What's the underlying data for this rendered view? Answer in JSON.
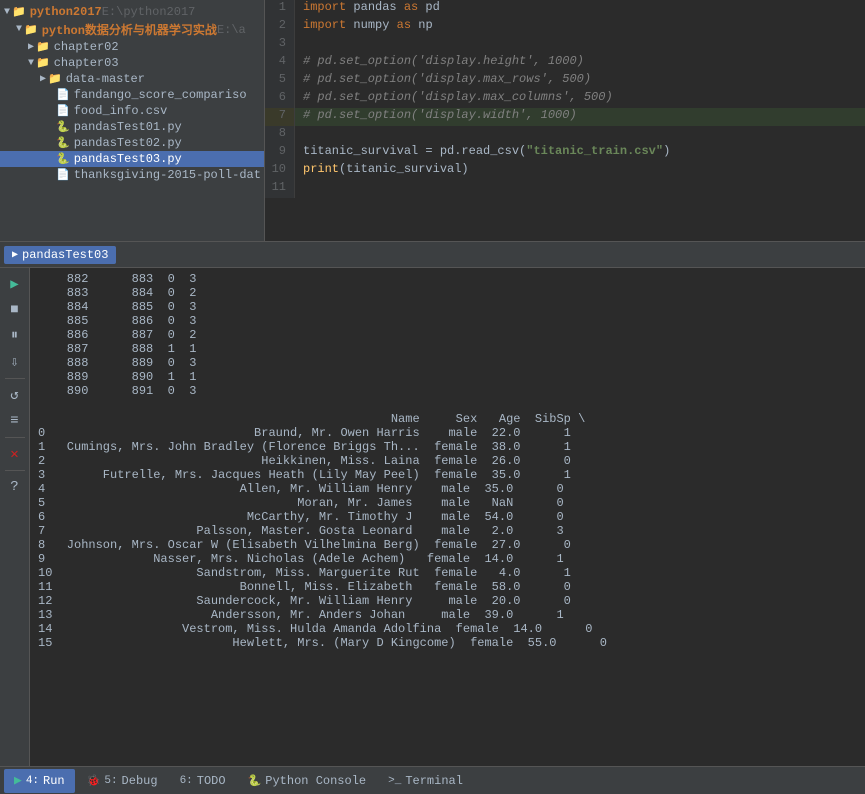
{
  "filetree": {
    "items": [
      {
        "id": "python2017",
        "label": "python2017",
        "path": "E:\\python2017",
        "type": "folder",
        "indent": 0,
        "expanded": true,
        "arrow": "▼"
      },
      {
        "id": "python-book",
        "label": "python数据分析与机器学习实战",
        "path": "E:\\a",
        "type": "folder",
        "indent": 1,
        "expanded": true,
        "arrow": "▼"
      },
      {
        "id": "chapter02",
        "label": "chapter02",
        "path": "",
        "type": "folder",
        "indent": 2,
        "expanded": false,
        "arrow": "▶"
      },
      {
        "id": "chapter03",
        "label": "chapter03",
        "path": "",
        "type": "folder",
        "indent": 2,
        "expanded": true,
        "arrow": "▼"
      },
      {
        "id": "data-master",
        "label": "data-master",
        "path": "",
        "type": "folder",
        "indent": 3,
        "expanded": false,
        "arrow": "▶"
      },
      {
        "id": "fandango",
        "label": "fandango_score_compariso",
        "path": "",
        "type": "csv",
        "indent": 3
      },
      {
        "id": "food_info",
        "label": "food_info.csv",
        "path": "",
        "type": "csv",
        "indent": 3
      },
      {
        "id": "pandasTest01",
        "label": "pandasTest01.py",
        "path": "",
        "type": "py",
        "indent": 3
      },
      {
        "id": "pandasTest02",
        "label": "pandasTest02.py",
        "path": "",
        "type": "py",
        "indent": 3
      },
      {
        "id": "pandasTest03",
        "label": "pandasTest03.py",
        "path": "",
        "type": "py",
        "indent": 3,
        "selected": true
      },
      {
        "id": "thanksgiving",
        "label": "thanksgiving-2015-poll-dat",
        "path": "",
        "type": "csv",
        "indent": 3
      }
    ]
  },
  "code": {
    "lines": [
      {
        "num": 1,
        "text": "import pandas as pd",
        "type": "import"
      },
      {
        "num": 2,
        "text": "import numpy as np",
        "type": "import"
      },
      {
        "num": 3,
        "text": "",
        "type": "blank"
      },
      {
        "num": 4,
        "text": "# pd.set_option('display.height', 1000)",
        "type": "comment"
      },
      {
        "num": 5,
        "text": "# pd.set_option('display.max_rows', 500)",
        "type": "comment"
      },
      {
        "num": 6,
        "text": "# pd.set_option('display.max_columns', 500)",
        "type": "comment"
      },
      {
        "num": 7,
        "text": "# pd.set_option('display.width', 1000)",
        "type": "comment",
        "highlighted": true
      },
      {
        "num": 8,
        "text": "",
        "type": "blank"
      },
      {
        "num": 9,
        "text": "titanic_survival = pd.read_csv(\"titanic_train.csv\")",
        "type": "code"
      },
      {
        "num": 10,
        "text": "print(titanic_survival)",
        "type": "code"
      },
      {
        "num": 11,
        "text": "",
        "type": "blank"
      }
    ]
  },
  "run_tab": {
    "label": "pandasTest03",
    "icon": "▶"
  },
  "toolbar_buttons": [
    {
      "id": "run",
      "icon": "▶",
      "color": "green"
    },
    {
      "id": "stop",
      "icon": "■",
      "color": "default"
    },
    {
      "id": "pause",
      "icon": "⏸",
      "color": "default"
    },
    {
      "id": "step",
      "icon": "⇩",
      "color": "default"
    },
    {
      "id": "rerun",
      "icon": "↺",
      "color": "default"
    },
    {
      "id": "settings",
      "icon": "≡",
      "color": "default"
    },
    {
      "id": "x",
      "icon": "✕",
      "color": "red"
    },
    {
      "id": "question",
      "icon": "?",
      "color": "default"
    }
  ],
  "console_output": {
    "top_table": [
      {
        "idx": "882",
        "col1": "883",
        "col2": "0",
        "col3": "3"
      },
      {
        "idx": "883",
        "col1": "884",
        "col2": "0",
        "col3": "2"
      },
      {
        "idx": "884",
        "col1": "885",
        "col2": "0",
        "col3": "3"
      },
      {
        "idx": "885",
        "col1": "886",
        "col2": "0",
        "col3": "3"
      },
      {
        "idx": "886",
        "col1": "887",
        "col2": "0",
        "col3": "2"
      },
      {
        "idx": "887",
        "col1": "888",
        "col2": "1",
        "col3": "1"
      },
      {
        "idx": "888",
        "col1": "889",
        "col2": "0",
        "col3": "3"
      },
      {
        "idx": "889",
        "col1": "890",
        "col2": "1",
        "col3": "1"
      },
      {
        "idx": "890",
        "col1": "891",
        "col2": "0",
        "col3": "3"
      }
    ],
    "main_table": {
      "header": "   Name                                              Sex    Age  SibSp \\",
      "rows": [
        {
          "num": "0",
          "name": "Braund, Mr. Owen Harris",
          "sex": "male",
          "age": "22.0",
          "sibsp": "1"
        },
        {
          "num": "1",
          "name": "Cumings, Mrs. John Bradley (Florence Briggs Th...",
          "sex": "female",
          "age": "38.0",
          "sibsp": "1"
        },
        {
          "num": "2",
          "name": "Heikkinen, Miss. Laina",
          "sex": "female",
          "age": "26.0",
          "sibsp": "0"
        },
        {
          "num": "3",
          "name": "Futrelle, Mrs. Jacques Heath (Lily May Peel)",
          "sex": "female",
          "age": "35.0",
          "sibsp": "1"
        },
        {
          "num": "4",
          "name": "Allen, Mr. William Henry",
          "sex": "male",
          "age": "35.0",
          "sibsp": "0"
        },
        {
          "num": "5",
          "name": "Moran, Mr. James",
          "sex": "male",
          "age": "NaN",
          "sibsp": "0"
        },
        {
          "num": "6",
          "name": "McCarthy, Mr. Timothy J",
          "sex": "male",
          "age": "54.0",
          "sibsp": "0"
        },
        {
          "num": "7",
          "name": "Palsson, Master. Gosta Leonard",
          "sex": "male",
          "age": "2.0",
          "sibsp": "3"
        },
        {
          "num": "8",
          "name": "Johnson, Mrs. Oscar W (Elisabeth Vilhelmina Berg)",
          "sex": "female",
          "age": "27.0",
          "sibsp": "0"
        },
        {
          "num": "9",
          "name": "Nasser, Mrs. Nicholas (Adele Achem)",
          "sex": "female",
          "age": "14.0",
          "sibsp": "1"
        },
        {
          "num": "10",
          "name": "Sandstrom, Miss. Marguerite Rut",
          "sex": "female",
          "age": "4.0",
          "sibsp": "1"
        },
        {
          "num": "11",
          "name": "Bonnell, Miss. Elizabeth",
          "sex": "female",
          "age": "58.0",
          "sibsp": "0"
        },
        {
          "num": "12",
          "name": "Saundercock, Mr. William Henry",
          "sex": "male",
          "age": "20.0",
          "sibsp": "0"
        },
        {
          "num": "13",
          "name": "Andersson, Mr. Anders Johan",
          "sex": "male",
          "age": "39.0",
          "sibsp": "1"
        },
        {
          "num": "14",
          "name": "Vestrom, Miss. Hulda Amanda Adolfina",
          "sex": "female",
          "age": "14.0",
          "sibsp": "0"
        },
        {
          "num": "15",
          "name": "Hewlett, Mrs. (Mary D Kingcome)",
          "sex": "female",
          "age": "55.0",
          "sibsp": "0"
        }
      ]
    }
  },
  "bottom_tabs": [
    {
      "id": "run",
      "num": "4",
      "label": "Run",
      "icon": "▶",
      "active": true
    },
    {
      "id": "debug",
      "num": "5",
      "label": "Debug",
      "icon": "🐞"
    },
    {
      "id": "todo",
      "num": "6",
      "label": "TODO",
      "icon": ""
    },
    {
      "id": "python-console",
      "num": "",
      "label": "Python Console",
      "icon": "🐍"
    },
    {
      "id": "terminal",
      "num": "",
      "label": "Terminal",
      "icon": ">_"
    }
  ]
}
